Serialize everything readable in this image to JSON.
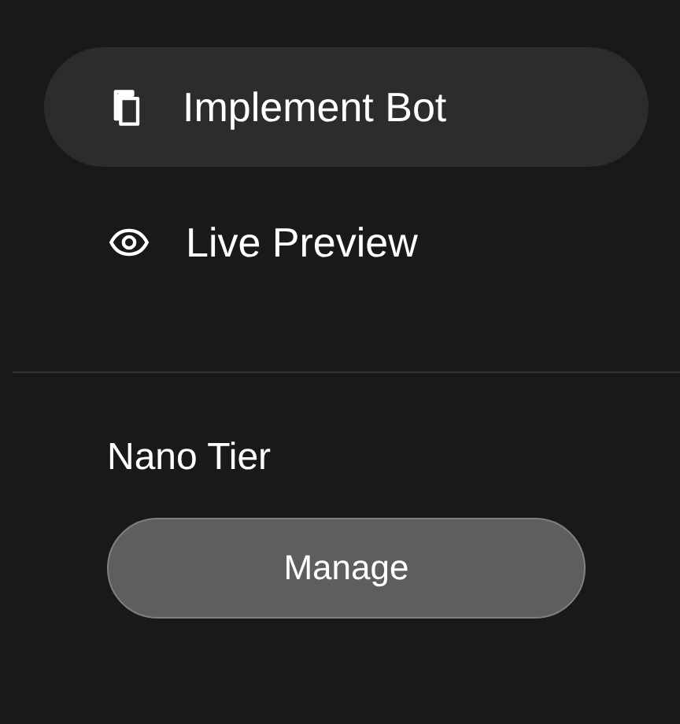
{
  "nav_items": [
    {
      "label": "Implement Bot",
      "selected": true
    },
    {
      "label": "Live Preview",
      "selected": false
    }
  ],
  "plan": {
    "name": "Nano Tier",
    "button": "Manage"
  }
}
